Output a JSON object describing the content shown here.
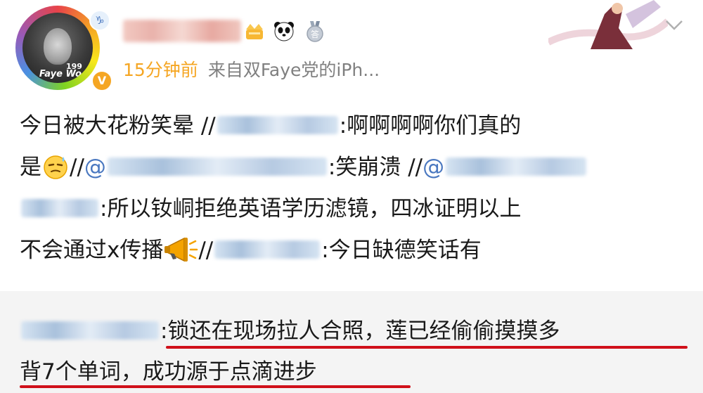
{
  "header": {
    "meta_time": "15分钟前",
    "meta_source": "来自双Faye党的iPh...",
    "avatar_caption": "Faye Wo",
    "avatar_number": "199",
    "zodiac_symbol": "♑",
    "verified_symbol": "V",
    "badge_text": "答"
  },
  "post": {
    "line1_a": "今日被大花粉笑晕 //",
    "line1_b": ":啊啊啊啊你们真的",
    "line2_a": "是",
    "line2_b": "//",
    "line2_c": "@",
    "line2_d": ":笑崩溃 //",
    "line2_e": "@",
    "line3_a": ":所以钕峒拒绝英语学历滤镜，四冰证明以上",
    "line4_a": "不会通过x传播",
    "line4_b": "//",
    "line4_c": ":今日缺德笑话有"
  },
  "retweet": {
    "line1": ":锁还在现场拉人合照，莲已经偷偷摸摸多",
    "line2": "背7个单词，成功源于点滴进步"
  },
  "colors": {
    "time": "#f5a623",
    "source": "#808080",
    "link": "#4a78c0",
    "underline": "#d0101a",
    "retweet_bg": "#f4f4f4"
  },
  "icons": [
    "zodiac-capricorn-icon",
    "verified-icon",
    "crown-icon",
    "panda-icon",
    "medal-icon",
    "chevron-down-icon",
    "sweat-smile-emoji-icon",
    "megaphone-emoji-icon"
  ]
}
